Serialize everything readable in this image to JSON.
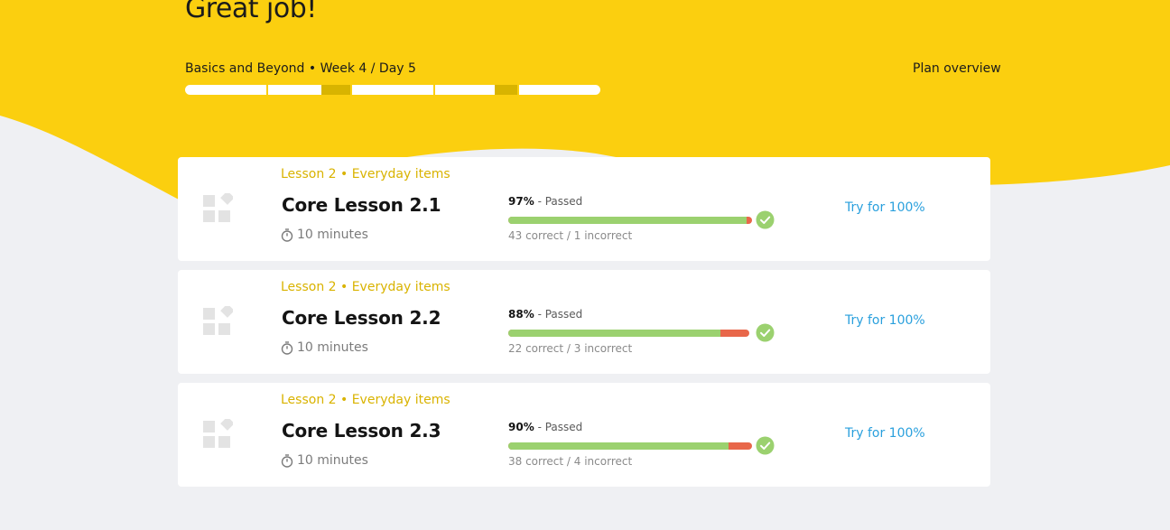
{
  "header": {
    "title": "Great job!",
    "plan_label": "Basics and Beyond • Week 4 / Day 5",
    "plan_overview_link": "Plan overview",
    "brand_color": "#fbcf0f"
  },
  "plan_progress": {
    "segments": [
      {
        "fill_start": 0.0,
        "fill_end": 0.0
      },
      {
        "fill_start": 0.65,
        "fill_end": 1.0
      },
      {
        "fill_start": 0.0,
        "fill_end": 0.0
      },
      {
        "fill_start": 0.73,
        "fill_end": 1.0
      },
      {
        "fill_start": 0.0,
        "fill_end": 0.0
      }
    ]
  },
  "lessons": [
    {
      "tag": "Lesson 2 • Everyday items",
      "title": "Core Lesson 2.1",
      "duration": "10 minutes",
      "score_pct": "97%",
      "status": "- Passed",
      "counts": "43 correct / 1 incorrect",
      "correct": 43,
      "incorrect": 1,
      "action": "Try for 100%"
    },
    {
      "tag": "Lesson 2 • Everyday items",
      "title": "Core Lesson 2.2",
      "duration": "10 minutes",
      "score_pct": "88%",
      "status": "- Passed",
      "counts": "22 correct / 3 incorrect",
      "correct": 22,
      "incorrect": 3,
      "action": "Try for 100%"
    },
    {
      "tag": "Lesson 2 • Everyday items",
      "title": "Core Lesson 2.3",
      "duration": "10 minutes",
      "score_pct": "90%",
      "status": "- Passed",
      "counts": "38 correct / 4 incorrect",
      "correct": 38,
      "incorrect": 4,
      "action": "Try for 100%"
    }
  ],
  "colors": {
    "correct": "#9bd16f",
    "incorrect": "#e8674a",
    "link": "#2aa0dd",
    "lesson_tag": "#d9b300"
  },
  "icons": {
    "lesson": "blocks-icon",
    "duration": "stopwatch-icon",
    "passed": "check-circle-icon"
  }
}
